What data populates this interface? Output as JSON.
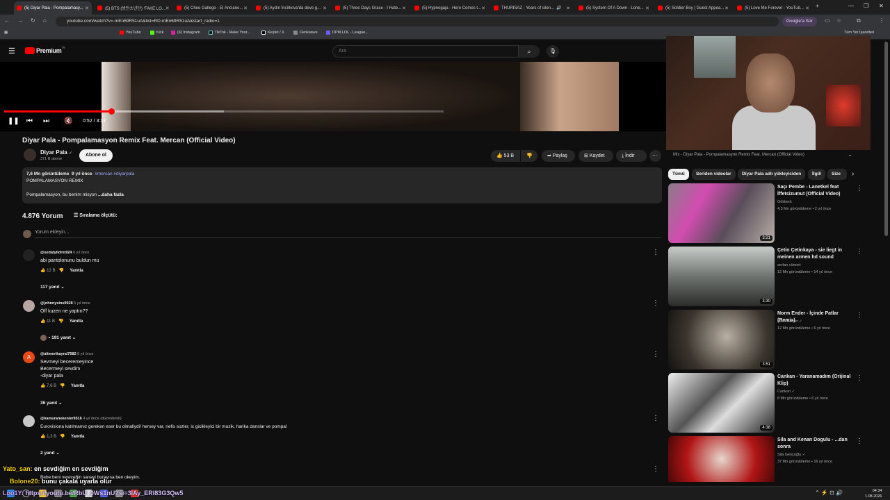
{
  "browser": {
    "tabs": [
      "(5) Diyar Pala - Pompalamasy...",
      "(5) BTS (방탄소년단) 'FAKE LO...",
      "(5) Cheo Gallego - El Anciano...",
      "(5) Aydın İncirkova'da deve g...",
      "(5) Three Days Grace - I Hate...",
      "(5) Hypnogaja - Here Comes t...",
      "THURISAZ - Years of silen...",
      "(5) System Of A Down - Lone...",
      "(5) Soldier Boy | Guest Appea...",
      "(5) Love Me Forever - YouTub..."
    ],
    "new_tab": "+",
    "url": "youtube.com/watch?v=-mEn69R51uA&list=RD-mEn69R51uA&start_radio=1",
    "google_btn": "Google'a Sor",
    "bookmarks": [
      "YouTube",
      "Kick",
      "(6) Instagram",
      "TikTok - Make Your...",
      "Keşfet / X",
      "Deokwave",
      "DPM.LOL - League..."
    ],
    "all_bookmarks": "Tüm Yer İşaretleri"
  },
  "yt": {
    "logo": "Premium",
    "logo_badge": "TR",
    "search_placeholder": "Ara",
    "player": {
      "time": "0:52 / 3:34",
      "progress": 0.243,
      "buffered": 0.5
    },
    "video": {
      "title": "Diyar Pala - Pompalamasyon Remix Feat. Mercan (Official Video)",
      "channel": "Diyar Pala",
      "verified": "✓",
      "subs": "371 B abone",
      "subscribe": "Abone ol",
      "likes": "53 B",
      "share": "Paylaş",
      "save": "Kaydet",
      "download": "İndir"
    },
    "description": {
      "views": "7,6 Mn görüntüleme",
      "age": "9 yıl önce",
      "tags": "#mercan #diyarpala",
      "line1": "POMPALAMASYON REMIX",
      "line2": "Pompalamasyon, bu benim misyon",
      "more": "...daha fazla"
    },
    "comments": {
      "count": "4.876 Yorum",
      "sort": "Sıralama ölçütü:",
      "add": "Yorum ekleyin...",
      "reply_label": "Yanıtla",
      "items": [
        {
          "user": "@sedatyildrm924",
          "age": "6 yıl önce",
          "text": [
            "abi pantolonunu buldun mu"
          ],
          "likes": "12 B",
          "replies": "117 yanıt"
        },
        {
          "user": "@johnnysins9928",
          "age": "5 yıl önce",
          "text": [
            "Öff kuzen ne yaptın??"
          ],
          "likes": "11 B",
          "replies": "• 191 yanıt"
        },
        {
          "user": "@alimertkayral7582",
          "age": "8 yıl önce",
          "text": [
            "Sevmeyi beceremeyince",
            "Becermeyi sevdim",
            "-diyar pala"
          ],
          "likes": "7,6 B",
          "replies": "36 yanıt",
          "initial": "A"
        },
        {
          "user": "@kamuranekenler9516",
          "age": "4 yıl önce (düzenlendi)",
          "text": [
            "Eurovisiona katılmamız gereken eser bu olmaliydi! hersey var, nefis sozler, ic gicikleyici bir muzik, harika danslar ve pompa!"
          ],
          "likes": "1,3 B",
          "replies": "2 yanıt"
        },
        {
          "user": "",
          "age": "",
          "text": [
            "Bebe beni vereceğin sanayi burayısa ben okeyim."
          ],
          "likes": "",
          "replies": ""
        }
      ]
    },
    "mix_title": "Mix - Diyar Pala - Pompalamasyon Remix Feat. Mercan (Official Video)",
    "chips": [
      "Tümü",
      "Seriden videolar",
      "Diyar Pala adlı yükleyiciden",
      "İlgili",
      "Size"
    ],
    "sidebar": [
      {
        "title": "Saçı Pembe - Lanetkel feat İffetsizumut (Official Video)",
        "channel": "Gökberk",
        "meta": "4,3 Mn görüntüleme • 2 yıl önce",
        "duration": "3:21"
      },
      {
        "title": "Çetin Çetinkaya - sie liegt in meinen armen hd sound",
        "channel": "sertan cömert",
        "meta": "12 Mn görüntüleme • 14 yıl önce",
        "duration": "3:30"
      },
      {
        "title": "Norm Ender - İçinde Patlar (Remix)",
        "channel": "Norm Ender",
        "meta": "12 Mn görüntüleme • 6 yıl önce",
        "duration": "3:51"
      },
      {
        "title": "Cankan - Yaranamadım (Orijinal Klip)",
        "channel": "Cankan",
        "meta": "8 Mn görüntüleme • 6 yıl önce",
        "duration": "4:38"
      },
      {
        "title": "Sila and Kenan Dogulu - ...dan sonra",
        "channel": "Sila Gençoğlu",
        "meta": "37 Mn görüntüleme • 16 yıl önce",
        "duration": ""
      }
    ]
  },
  "overlay_chat": [
    {
      "user": "Yato_san:",
      "msg": "en sevdiğim en sevdiğim",
      "color": "#f5d400"
    },
    {
      "user": "Bolone20:",
      "msg": "bunu çakala uyarla olur",
      "color": "#e8c800"
    },
    {
      "user": "Loo1Y:",
      "msg": "https://youtu.be/RbU_0Ws1nU?si=3lAy_ERl83G3Qw5",
      "color": "#c8a0ff"
    }
  ],
  "clock": {
    "time": "04:34",
    "date": "1.08.2026"
  }
}
